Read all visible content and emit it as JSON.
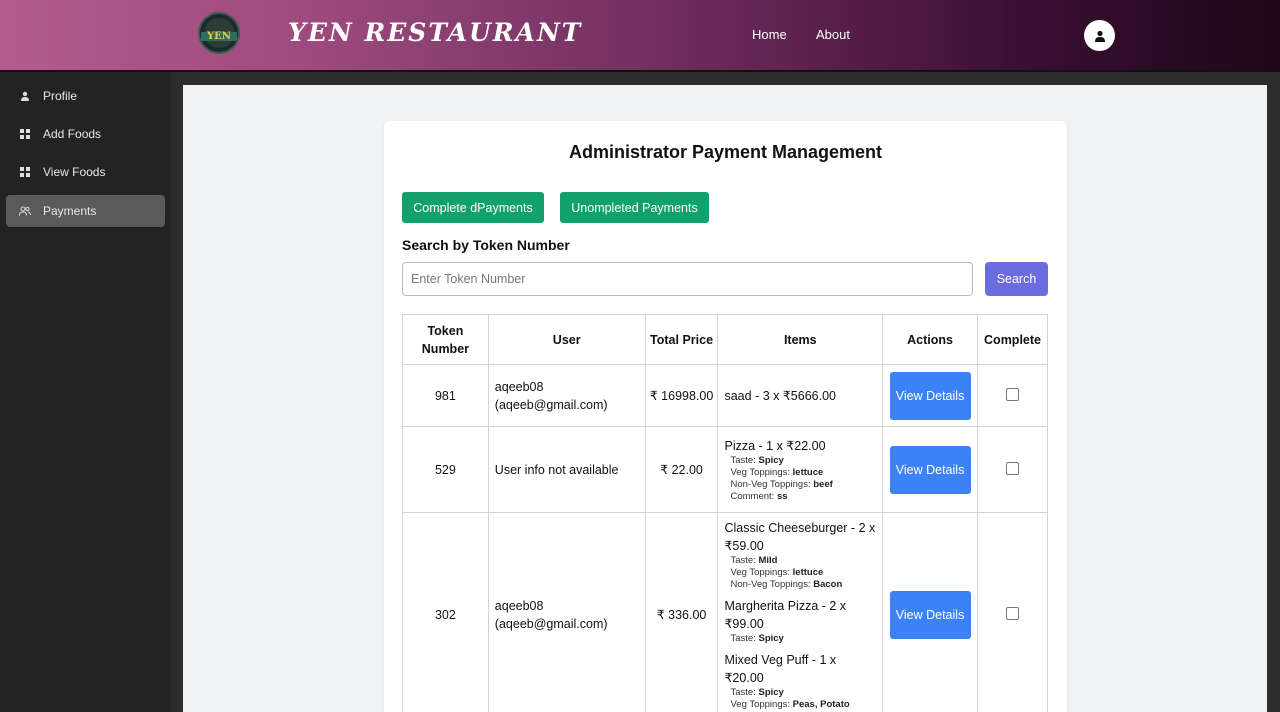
{
  "header": {
    "brand": "YEN RESTAURANT",
    "logo_text": "YEN",
    "nav": {
      "home": "Home",
      "about": "About"
    }
  },
  "sidebar": {
    "items": [
      {
        "label": "Profile",
        "icon": "person-icon"
      },
      {
        "label": "Add Foods",
        "icon": "grid-icon"
      },
      {
        "label": "View Foods",
        "icon": "grid-icon"
      },
      {
        "label": "Payments",
        "icon": "users-icon",
        "active": true
      }
    ]
  },
  "main": {
    "title": "Administrator Payment Management",
    "buttons": {
      "complete": "Complete dPayments",
      "uncomplete": "Unompleted Payments"
    },
    "search": {
      "label": "Search by Token Number",
      "placeholder": "Enter Token Number",
      "button": "Search"
    },
    "table": {
      "headers": [
        "Token Number",
        "User",
        "Total Price",
        "Items",
        "Actions",
        "Complete"
      ],
      "view_label": "View Details",
      "rows": [
        {
          "token": "981",
          "user": "aqeeb08 (aqeeb@gmail.com)",
          "price": "₹ 16998.00",
          "items": [
            {
              "line": "saad - 3 x ₹5666.00"
            }
          ]
        },
        {
          "token": "529",
          "user": "User info not available",
          "price": "₹ 22.00",
          "items": [
            {
              "line": "Pizza - 1 x ₹22.00",
              "taste": "Spicy",
              "veg": "lettuce",
              "nonveg": "beef",
              "comment": "ss"
            }
          ]
        },
        {
          "token": "302",
          "user": "aqeeb08 (aqeeb@gmail.com)",
          "price": "₹ 336.00",
          "items": [
            {
              "line": "Classic Cheeseburger - 2 x ₹59.00",
              "taste": "Mild",
              "veg": "lettuce",
              "nonveg": "Bacon"
            },
            {
              "line": "Margherita Pizza - 2 x ₹99.00",
              "taste": "Spicy"
            },
            {
              "line": "Mixed Veg Puff - 1 x ₹20.00",
              "taste": "Spicy",
              "veg": "Peas, Potato"
            }
          ]
        }
      ]
    }
  },
  "labels": {
    "taste": "Taste:",
    "veg": "Veg Toppings:",
    "nonveg": "Non-Veg Toppings:",
    "comment": "Comment:"
  },
  "colors": {
    "header_gradient_start": "#b35c8c",
    "header_gradient_end": "#1e0619",
    "sidebar_bg": "#232323",
    "green_button": "#12a06c",
    "search_button": "#6c6ce0",
    "view_button": "#3b82f6"
  }
}
